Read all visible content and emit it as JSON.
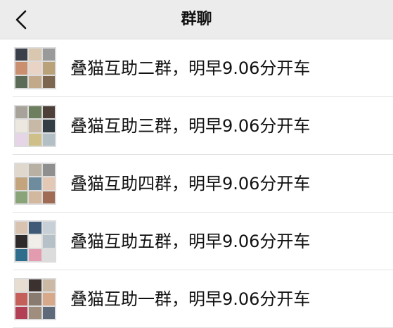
{
  "header": {
    "title": "群聊",
    "back_icon": "chevron-left-icon"
  },
  "groups": [
    {
      "name": "叠猫互助二群，明早9.06分开车",
      "avatar_colors": [
        "#3b3f4a",
        "#d9c7b0",
        "#9a9a9a",
        "#c98f6e",
        "#e8d3c5",
        "#b9a27a",
        "#5b6b55",
        "#c2a98a",
        "#7c6650"
      ]
    },
    {
      "name": "叠猫互助三群，明早9.06分开车",
      "avatar_colors": [
        "#a7a39a",
        "#6d7f5e",
        "#4c4038",
        "#ece7df",
        "#c7b9a5",
        "#333d44",
        "#e6d5e6",
        "#cfc089",
        "#b2bfc4"
      ]
    },
    {
      "name": "叠猫互助四群，明早9.06分开车",
      "avatar_colors": [
        "#e0d8cc",
        "#b8b1a3",
        "#8f8f8f",
        "#c4a47d",
        "#6f8c9e",
        "#e3c9b5",
        "#8aa47a",
        "#d3b8a0",
        "#a06b55"
      ]
    },
    {
      "name": "叠猫互助五群，明早9.06分开车",
      "avatar_colors": [
        "#d7c3b0",
        "#3f5a77",
        "#c7d0d6",
        "#2e2a2b",
        "#f1eee9",
        "#b5c0c7",
        "#2f6d8c",
        "#e39bb0",
        "#dcdcdc"
      ]
    },
    {
      "name": "叠猫互助一群，明早9.06分开车",
      "avatar_colors": [
        "#e7ddd1",
        "#3b3230",
        "#cbb9a6",
        "#c45f5a",
        "#8a7b70",
        "#d8a88a",
        "#b33f57",
        "#9f8d7d",
        "#5e6a7a"
      ]
    }
  ]
}
